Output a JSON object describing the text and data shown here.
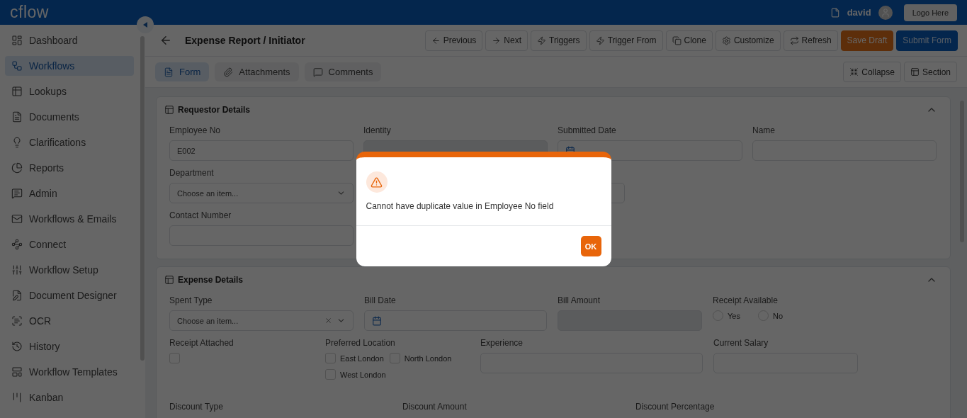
{
  "topbar": {
    "logo": "cflow",
    "user": "david",
    "logo_button": "Logo Here"
  },
  "sidebar": {
    "items": [
      {
        "label": "Dashboard",
        "selected": false
      },
      {
        "label": "Workflows",
        "selected": true
      },
      {
        "label": "Lookups",
        "selected": false
      },
      {
        "label": "Documents",
        "selected": false
      },
      {
        "label": "Clarifications",
        "selected": false
      },
      {
        "label": "Reports",
        "selected": false
      },
      {
        "label": "Admin",
        "selected": false
      },
      {
        "label": "Workflows & Emails",
        "selected": false
      },
      {
        "label": "Connect",
        "selected": false
      },
      {
        "label": "Workflow Setup",
        "selected": false
      },
      {
        "label": "Document Designer",
        "selected": false
      },
      {
        "label": "OCR",
        "selected": false
      },
      {
        "label": "History",
        "selected": false
      },
      {
        "label": "Workflow Templates",
        "selected": false
      },
      {
        "label": "Kanban",
        "selected": false
      }
    ]
  },
  "header": {
    "title": "Expense Report / Initiator",
    "actions": [
      {
        "label": "Previous",
        "kind": "plain"
      },
      {
        "label": "Next",
        "kind": "plain"
      },
      {
        "label": "Triggers",
        "kind": "plain"
      },
      {
        "label": "Trigger From",
        "kind": "plain"
      },
      {
        "label": "Clone",
        "kind": "plain"
      },
      {
        "label": "Customize",
        "kind": "plain"
      },
      {
        "label": "Refresh",
        "kind": "plain"
      },
      {
        "label": "Save Draft",
        "kind": "draft"
      },
      {
        "label": "Submit Form",
        "kind": "submit"
      }
    ]
  },
  "tabs": [
    {
      "label": "Form",
      "selected": true
    },
    {
      "label": "Attachments",
      "selected": false
    },
    {
      "label": "Comments",
      "selected": false
    }
  ],
  "view_buttons": [
    "Collapse",
    "Section"
  ],
  "sections": [
    {
      "title": "Requestor Details",
      "expanded": true,
      "rows": [
        {
          "fields": [
            {
              "kind": "text",
              "label": "Employee No",
              "value": "E002",
              "disabled": false
            },
            {
              "kind": "text",
              "label": "Identity",
              "disabled": true
            },
            {
              "kind": "date",
              "label": "Submitted Date"
            },
            {
              "kind": "text",
              "label": "Name",
              "disabled": false
            }
          ]
        },
        {
          "fields": [
            {
              "kind": "select",
              "label": "Department",
              "placeholder": "Choose an item...",
              "clearable": false
            },
            {
              "kind": "text",
              "disabled": false
            }
          ]
        },
        {
          "fields": [
            {
              "kind": "text",
              "label": "Contact Number",
              "disabled": false
            }
          ]
        }
      ]
    },
    {
      "title": "Expense Details",
      "expanded": true,
      "rows": [
        {
          "fields": [
            {
              "kind": "select",
              "label": "Spent Type",
              "placeholder": "Choose an item...",
              "clearable": true
            },
            {
              "kind": "date",
              "label": "Bill Date"
            },
            {
              "kind": "text",
              "label": "Bill Amount",
              "disabled": true
            },
            {
              "kind": "radio",
              "label": "Receipt Available",
              "options": [
                {
                  "label": "Yes",
                  "selected": false
                },
                {
                  "label": "No",
                  "selected": false
                }
              ]
            }
          ]
        },
        {
          "fields": [
            {
              "kind": "checkbox",
              "label": "Receipt Attached",
              "checked": false
            },
            {
              "kind": "checkgroup",
              "label": "Preferred Location",
              "options": [
                {
                  "label": "East London",
                  "checked": false
                },
                {
                  "label": "North London",
                  "checked": false
                },
                {
                  "label": "West London",
                  "checked": false
                }
              ]
            },
            {
              "kind": "text",
              "label": "Experience",
              "disabled": false
            },
            {
              "kind": "text",
              "label": "Current Salary",
              "disabled": false
            }
          ]
        },
        {
          "fields": [
            {
              "kind": "labelonly",
              "label": "Discount Type"
            },
            {
              "kind": "labelonly",
              "label": "Discount Amount"
            },
            {
              "kind": "labelonly",
              "label": "Discount Percentage"
            }
          ]
        }
      ]
    }
  ],
  "dialog": {
    "message": "Cannot have duplicate value in Employee No field",
    "button": "OK"
  }
}
